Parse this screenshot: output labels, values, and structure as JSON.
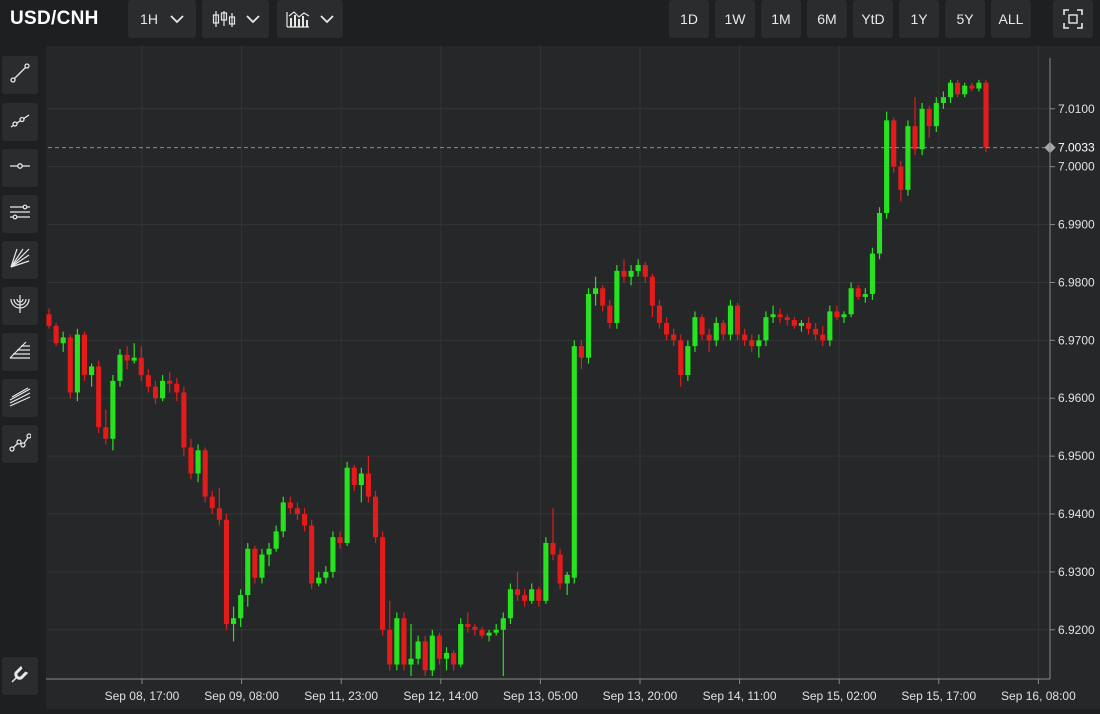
{
  "toolbar": {
    "symbol": "USD/CNH",
    "interval": "1H",
    "ranges": [
      "1D",
      "1W",
      "1M",
      "6M",
      "YtD",
      "1Y",
      "5Y",
      "ALL"
    ]
  },
  "colors": {
    "up": "#26e31f",
    "down": "#e31b1b",
    "background": "#262728",
    "grid": "#343536"
  },
  "chart_data": {
    "type": "candlestick",
    "title": "USD/CNH",
    "interval": "1H",
    "ylim": [
      6.9115,
      7.0205
    ],
    "yticks": [
      6.92,
      6.93,
      6.94,
      6.95,
      6.96,
      6.97,
      6.98,
      6.99,
      7.0,
      7.01
    ],
    "ytick_labels": [
      "6.9200",
      "6.9300",
      "6.9400",
      "6.9500",
      "6.9600",
      "6.9700",
      "6.9800",
      "6.9900",
      "7.0000",
      "7.0100"
    ],
    "xtick_labels": [
      "Sep 08, 17:00",
      "Sep 09, 08:00",
      "Sep 11, 23:00",
      "Sep 12, 14:00",
      "Sep 13, 05:00",
      "Sep 13, 20:00",
      "Sep 14, 11:00",
      "Sep 15, 02:00",
      "Sep 15, 17:00",
      "Sep 16, 08:00"
    ],
    "last_price": 7.0033,
    "last_price_label": "7.0033",
    "grid": true,
    "candles": [
      [
        6.9745,
        6.9755,
        6.972,
        6.9725
      ],
      [
        6.9725,
        6.973,
        6.969,
        6.9695
      ],
      [
        6.9695,
        6.9715,
        6.968,
        6.9705
      ],
      [
        6.9705,
        6.971,
        6.96,
        6.961
      ],
      [
        6.961,
        6.972,
        6.9595,
        6.971
      ],
      [
        6.971,
        6.9715,
        6.963,
        6.964
      ],
      [
        6.964,
        6.966,
        6.962,
        6.9655
      ],
      [
        6.9655,
        6.9665,
        6.954,
        6.955
      ],
      [
        6.955,
        6.958,
        6.952,
        6.953
      ],
      [
        6.953,
        6.964,
        6.951,
        6.963
      ],
      [
        6.963,
        6.9685,
        6.962,
        6.9675
      ],
      [
        6.9675,
        6.969,
        6.965,
        6.9665
      ],
      [
        6.9665,
        6.9695,
        6.966,
        6.967
      ],
      [
        6.967,
        6.969,
        6.963,
        6.964
      ],
      [
        6.964,
        6.965,
        6.961,
        6.962
      ],
      [
        6.962,
        6.963,
        6.959,
        6.96
      ],
      [
        6.96,
        6.964,
        6.9595,
        6.963
      ],
      [
        6.963,
        6.9645,
        6.961,
        6.9625
      ],
      [
        6.9625,
        6.9635,
        6.9595,
        6.961
      ],
      [
        6.961,
        6.962,
        6.95,
        6.9515
      ],
      [
        6.9515,
        6.953,
        6.946,
        6.947
      ],
      [
        6.947,
        6.952,
        6.9455,
        6.951
      ],
      [
        6.951,
        6.9515,
        6.942,
        6.943
      ],
      [
        6.943,
        6.944,
        6.94,
        6.941
      ],
      [
        6.941,
        6.9445,
        6.938,
        6.939
      ],
      [
        6.939,
        6.94,
        6.92,
        6.921
      ],
      [
        6.921,
        6.924,
        6.918,
        6.922
      ],
      [
        6.922,
        6.927,
        6.9205,
        6.926
      ],
      [
        6.926,
        6.935,
        6.924,
        6.934
      ],
      [
        6.934,
        6.9345,
        6.928,
        6.929
      ],
      [
        6.929,
        6.934,
        6.928,
        6.933
      ],
      [
        6.933,
        6.935,
        6.931,
        6.934
      ],
      [
        6.934,
        6.938,
        6.9335,
        6.937
      ],
      [
        6.937,
        6.943,
        6.936,
        6.942
      ],
      [
        6.942,
        6.943,
        6.94,
        6.941
      ],
      [
        6.941,
        6.942,
        6.939,
        6.94
      ],
      [
        6.94,
        6.941,
        6.937,
        6.938
      ],
      [
        6.938,
        6.939,
        6.927,
        6.928
      ],
      [
        6.928,
        6.93,
        6.9275,
        6.929
      ],
      [
        6.929,
        6.931,
        6.928,
        6.93
      ],
      [
        6.93,
        6.937,
        6.929,
        6.936
      ],
      [
        6.936,
        6.937,
        6.934,
        6.935
      ],
      [
        6.935,
        6.949,
        6.9345,
        6.948
      ],
      [
        6.948,
        6.9485,
        6.944,
        6.945
      ],
      [
        6.945,
        6.948,
        6.942,
        6.947
      ],
      [
        6.947,
        6.95,
        6.942,
        6.943
      ],
      [
        6.943,
        6.944,
        6.935,
        6.936
      ],
      [
        6.936,
        6.937,
        6.919,
        6.92
      ],
      [
        6.92,
        6.925,
        6.913,
        6.914
      ],
      [
        6.914,
        6.923,
        6.913,
        6.922
      ],
      [
        6.922,
        6.923,
        6.913,
        6.914
      ],
      [
        6.914,
        6.921,
        6.912,
        6.915
      ],
      [
        6.915,
        6.919,
        6.914,
        6.918
      ],
      [
        6.918,
        6.919,
        6.912,
        6.913
      ],
      [
        6.913,
        6.92,
        6.912,
        6.919
      ],
      [
        6.919,
        6.9195,
        6.914,
        6.915
      ],
      [
        6.915,
        6.917,
        6.913,
        6.916
      ],
      [
        6.916,
        6.9165,
        6.913,
        6.914
      ],
      [
        6.914,
        6.922,
        6.9135,
        6.921
      ],
      [
        6.921,
        6.923,
        6.9195,
        6.9205
      ],
      [
        6.9205,
        6.921,
        6.919,
        6.92
      ],
      [
        6.92,
        6.9205,
        6.9185,
        6.919
      ],
      [
        6.919,
        6.92,
        6.918,
        6.9195
      ],
      [
        6.9195,
        6.921,
        6.919,
        6.92
      ],
      [
        6.92,
        6.923,
        6.912,
        6.922
      ],
      [
        6.922,
        6.928,
        6.921,
        6.927
      ],
      [
        6.927,
        6.93,
        6.925,
        6.926
      ],
      [
        6.926,
        6.927,
        6.924,
        6.925
      ],
      [
        6.925,
        6.928,
        6.9245,
        6.927
      ],
      [
        6.927,
        6.9275,
        6.924,
        6.925
      ],
      [
        6.925,
        6.936,
        6.9245,
        6.935
      ],
      [
        6.935,
        6.941,
        6.932,
        6.933
      ],
      [
        6.933,
        6.934,
        6.927,
        6.928
      ],
      [
        6.928,
        6.93,
        6.926,
        6.9295
      ],
      [
        6.929,
        6.97,
        6.928,
        6.969
      ],
      [
        6.969,
        6.97,
        6.965,
        6.967
      ],
      [
        6.967,
        6.979,
        6.966,
        6.978
      ],
      [
        6.978,
        6.981,
        6.976,
        6.979
      ],
      [
        6.979,
        6.9795,
        6.975,
        6.976
      ],
      [
        6.976,
        6.977,
        6.972,
        6.973
      ],
      [
        6.973,
        6.983,
        6.972,
        6.982
      ],
      [
        6.982,
        6.984,
        6.98,
        6.981
      ],
      [
        6.981,
        6.983,
        6.9795,
        6.982
      ],
      [
        6.982,
        6.984,
        6.981,
        6.983
      ],
      [
        6.983,
        6.9835,
        6.98,
        6.981
      ],
      [
        6.981,
        6.9815,
        6.974,
        6.976
      ],
      [
        6.976,
        6.977,
        6.972,
        6.973
      ],
      [
        6.973,
        6.974,
        6.97,
        6.971
      ],
      [
        6.971,
        6.972,
        6.969,
        6.97
      ],
      [
        6.97,
        6.971,
        6.962,
        6.964
      ],
      [
        6.964,
        6.97,
        6.963,
        6.969
      ],
      [
        6.969,
        6.975,
        6.968,
        6.974
      ],
      [
        6.974,
        6.9745,
        6.97,
        6.971
      ],
      [
        6.971,
        6.972,
        6.968,
        6.97
      ],
      [
        6.97,
        6.974,
        6.969,
        6.973
      ],
      [
        6.973,
        6.9735,
        6.97,
        6.971
      ],
      [
        6.971,
        6.977,
        6.97,
        6.976
      ],
      [
        6.976,
        6.9765,
        6.97,
        6.971
      ],
      [
        6.971,
        6.972,
        6.969,
        6.97
      ],
      [
        6.97,
        6.971,
        6.968,
        6.969
      ],
      [
        6.969,
        6.971,
        6.967,
        6.97
      ],
      [
        6.97,
        6.975,
        6.969,
        6.974
      ],
      [
        6.974,
        6.976,
        6.973,
        6.9745
      ],
      [
        6.9745,
        6.9755,
        6.973,
        6.974
      ],
      [
        6.974,
        6.9745,
        6.9725,
        6.9735
      ],
      [
        6.9735,
        6.974,
        6.972,
        6.9725
      ],
      [
        6.9725,
        6.9735,
        6.9715,
        6.973
      ],
      [
        6.973,
        6.974,
        6.971,
        6.972
      ],
      [
        6.972,
        6.973,
        6.97,
        6.971
      ],
      [
        6.971,
        6.9725,
        6.969,
        6.97
      ],
      [
        6.97,
        6.976,
        6.969,
        6.975
      ],
      [
        6.975,
        6.976,
        6.9735,
        6.974
      ],
      [
        6.974,
        6.975,
        6.973,
        6.9745
      ],
      [
        6.9745,
        6.98,
        6.974,
        6.979
      ],
      [
        6.979,
        6.9795,
        6.977,
        6.9775
      ],
      [
        6.9775,
        6.979,
        6.9765,
        6.978
      ],
      [
        6.978,
        6.986,
        6.977,
        6.985
      ],
      [
        6.985,
        6.993,
        6.984,
        6.992
      ],
      [
        6.992,
        7.0095,
        6.991,
        7.008
      ],
      [
        7.008,
        7.0085,
        6.999,
        7.0
      ],
      [
        7.0,
        7.001,
        6.994,
        6.996
      ],
      [
        6.996,
        7.008,
        6.995,
        7.007
      ],
      [
        7.007,
        7.012,
        7.002,
        7.003
      ],
      [
        7.003,
        7.011,
        7.002,
        7.01
      ],
      [
        7.01,
        7.0105,
        7.005,
        7.007
      ],
      [
        7.007,
        7.012,
        7.006,
        7.011
      ],
      [
        7.011,
        7.013,
        7.01,
        7.012
      ],
      [
        7.012,
        7.015,
        7.011,
        7.0145
      ],
      [
        7.0145,
        7.015,
        7.012,
        7.0125
      ],
      [
        7.0125,
        7.0145,
        7.012,
        7.014
      ],
      [
        7.014,
        7.0145,
        7.013,
        7.0135
      ],
      [
        7.0135,
        7.015,
        7.013,
        7.0145
      ],
      [
        7.0145,
        7.015,
        7.0025,
        7.0033
      ]
    ]
  }
}
